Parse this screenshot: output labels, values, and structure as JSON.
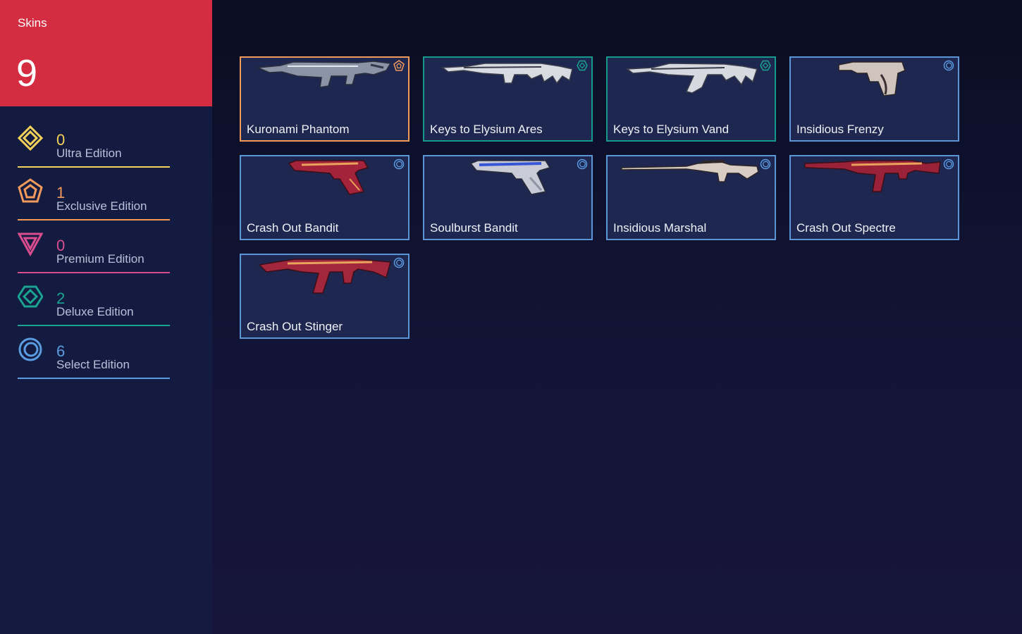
{
  "summary": {
    "title": "Skins",
    "total": "9"
  },
  "tiers": [
    {
      "count": "0",
      "label": "Ultra Edition",
      "color": "#f4d25a",
      "icon": "ultra-edition-icon"
    },
    {
      "count": "1",
      "label": "Exclusive Edition",
      "color": "#f29a5c",
      "icon": "exclusive-edition-icon"
    },
    {
      "count": "0",
      "label": "Premium Edition",
      "color": "#d94d8f",
      "icon": "premium-edition-icon"
    },
    {
      "count": "2",
      "label": "Deluxe Edition",
      "color": "#1aa491",
      "icon": "deluxe-edition-icon"
    },
    {
      "count": "6",
      "label": "Select Edition",
      "color": "#5b9be0",
      "icon": "select-edition-icon"
    }
  ],
  "skins": [
    {
      "name": "Kuronami Phantom",
      "tier": "exclusive",
      "icon": "phantom-rifle-icon"
    },
    {
      "name": "Keys to Elysium Ares",
      "tier": "deluxe",
      "icon": "ares-machine-gun-icon"
    },
    {
      "name": "Keys to Elysium Vand",
      "tier": "deluxe",
      "icon": "vandal-rifle-icon"
    },
    {
      "name": "Insidious Frenzy",
      "tier": "select",
      "icon": "frenzy-pistol-icon"
    },
    {
      "name": "Crash Out Bandit",
      "tier": "select",
      "icon": "bandit-pistol-icon"
    },
    {
      "name": "Soulburst Bandit",
      "tier": "select",
      "icon": "bandit-pistol-icon"
    },
    {
      "name": "Insidious Marshal",
      "tier": "select",
      "icon": "marshal-sniper-icon"
    },
    {
      "name": "Crash Out Spectre",
      "tier": "select",
      "icon": "spectre-smg-icon"
    },
    {
      "name": "Crash Out Stinger",
      "tier": "select",
      "icon": "stinger-smg-icon"
    }
  ]
}
